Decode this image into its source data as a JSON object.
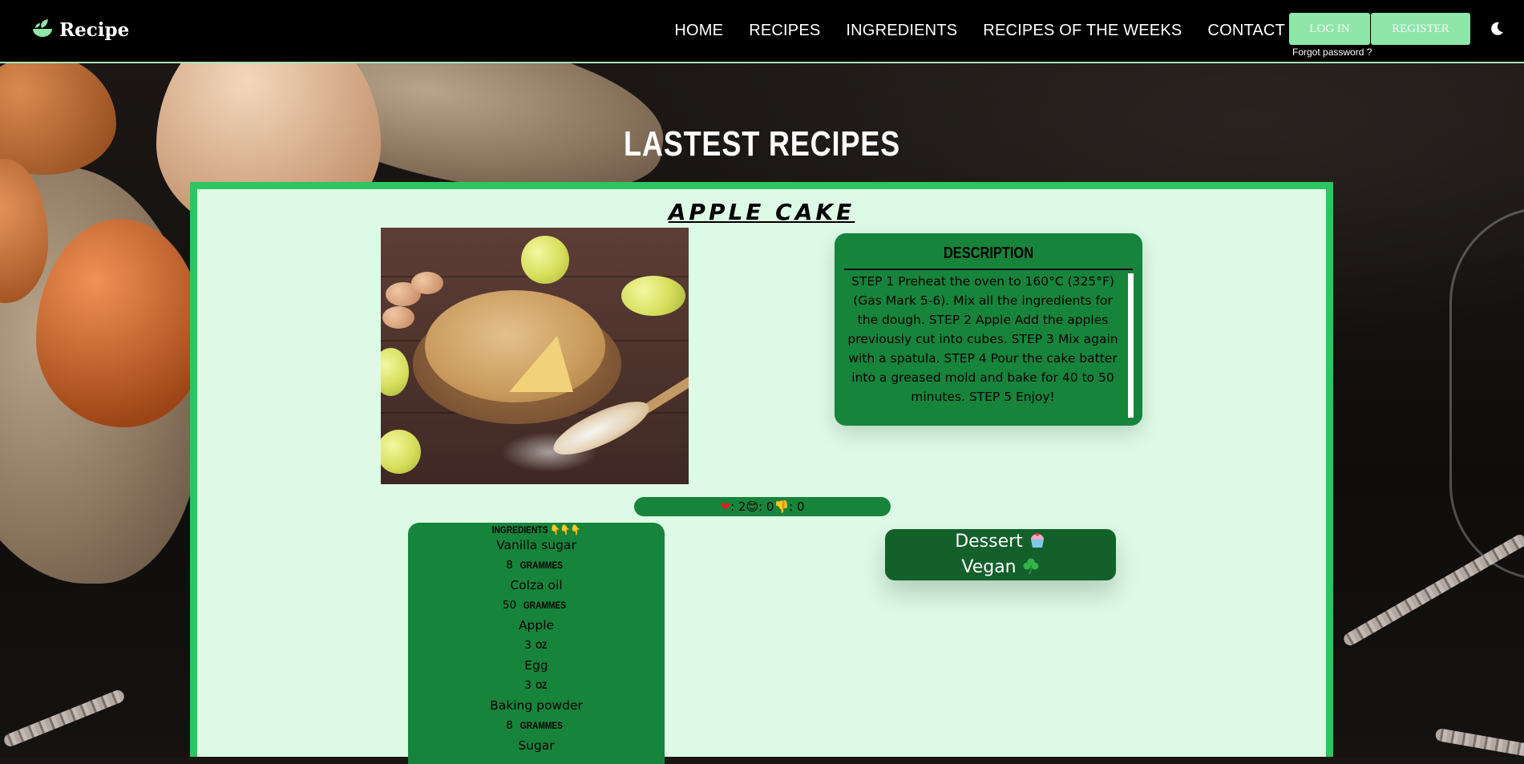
{
  "header": {
    "brand": "Recipe",
    "nav": [
      "HOME",
      "RECIPES",
      "INGREDIENTS",
      "RECIPES OF THE WEEKS",
      "CONTACT"
    ],
    "login_label": "LOG IN",
    "register_label": "REGISTER",
    "forgot_label": "Forgot password ?",
    "theme_icon": "moon-icon"
  },
  "section": {
    "title": "LASTEST RECIPES"
  },
  "recipe": {
    "name": "APPLE CAKE",
    "description_title": "DESCRIPTION",
    "description": "STEP 1 Preheat the oven to 160°C (325°F) (Gas Mark 5-6). Mix all the ingredients for the dough. STEP 2 Apple Add the apples previously cut into cubes. STEP 3 Mix again with a spatula. STEP 4 Pour the cake batter into a greased mold and bake for 40 to 50 minutes. STEP 5 Enjoy!",
    "reactions": {
      "likes": ": 2",
      "smiles": ": 0",
      "dislikes": ": 0"
    },
    "ingredients_title": "INGREDIENTS 👇👇👇",
    "ingredients": [
      {
        "name": "Vanilla sugar",
        "qty": "8",
        "unit": "GRAMMES"
      },
      {
        "name": "Colza oil",
        "qty": "50",
        "unit": "GRAMMES"
      },
      {
        "name": "Apple",
        "qty": "3",
        "unit": "OZ"
      },
      {
        "name": "Egg",
        "qty": "3",
        "unit": "OZ"
      },
      {
        "name": "Baking powder",
        "qty": "8",
        "unit": "GRAMMES"
      },
      {
        "name": "Sugar",
        "qty": "",
        "unit": ""
      }
    ],
    "tags": [
      {
        "label": "Dessert",
        "icon": "cupcake-icon"
      },
      {
        "label": "Vegan",
        "icon": "shamrock-icon"
      }
    ]
  },
  "colors": {
    "nav_bg": "#000000",
    "accent_button": "#8ee6a9",
    "card_bg": "#ddfae6",
    "card_border": "#2ec461",
    "panel_green": "#16843b",
    "tag_green": "#13602b"
  }
}
